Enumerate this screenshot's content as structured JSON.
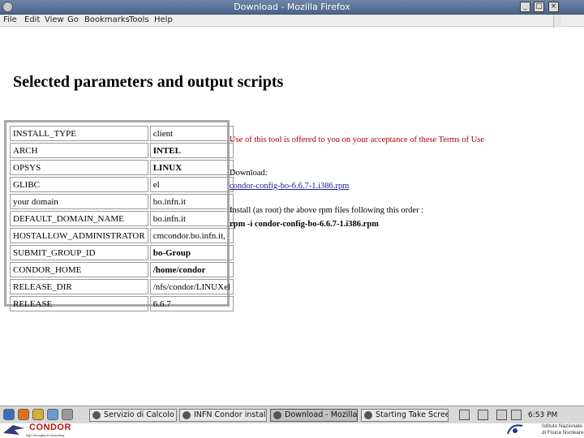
{
  "window": {
    "title": "Download - Mozilla Firefox"
  },
  "menu": [
    "File",
    "Edit",
    "View",
    "Go",
    "Bookmarks",
    "Tools",
    "Help"
  ],
  "page": {
    "heading": "Selected parameters and output scripts",
    "params": [
      {
        "key": "INSTALL_TYPE",
        "value": "client",
        "bold": false
      },
      {
        "key": "ARCH",
        "value": "INTEL",
        "bold": true
      },
      {
        "key": "OPSYS",
        "value": "LINUX",
        "bold": true
      },
      {
        "key": "GLIBC",
        "value": "el",
        "bold": false
      },
      {
        "key": "your domain",
        "value": "bo.infn.it",
        "bold": false
      },
      {
        "key": "DEFAULT_DOMAIN_NAME",
        "value": "bo.infn.it",
        "bold": false
      },
      {
        "key": "HOSTALLOW_ADMINISTRATOR",
        "value": "cmcondor.bo.infn.it,",
        "bold": false
      },
      {
        "key": "SUBMIT_GROUP_ID",
        "value": "bo-Group",
        "bold": true
      },
      {
        "key": "CONDOR_HOME",
        "value": "/home/condor",
        "bold": true
      },
      {
        "key": "RELEASE_DIR",
        "value": "/nfs/condor/LINUXel",
        "bold": false
      },
      {
        "key": "RELEASE",
        "value": "6.6.7",
        "bold": false
      }
    ],
    "notice_prefix": "Use of this tool is offered to you on your acceptance of these ",
    "terms_link": "Terms of Use",
    "download_label": "Download:",
    "download_link": "condor-config-bo-6.6.7-1.i386.rpm",
    "install_text": "Install (as root) the above rpm files following this order :",
    "install_cmd": "rpm -i condor-config-bo-6.6.7-1.i386.rpm"
  },
  "taskbar": {
    "tasks": [
      {
        "label": "Servizio di Calcolo ...",
        "active": false
      },
      {
        "label": "INFN Condor install...",
        "active": false
      },
      {
        "label": "Download - Mozilla ...",
        "active": true
      },
      {
        "label": "Starting Take Scree...",
        "active": false
      }
    ],
    "clock": "6:53 PM"
  },
  "footer": {
    "logo_word": "CONDOR",
    "logo_tagline": "high throughput computing",
    "institute": "Istituto Nazionale di Fisica Nucleare"
  },
  "colors": {
    "titlebar": "#4a6388",
    "notice": "#b00000",
    "link": "#1a1a8c",
    "logo": "#c01010"
  }
}
